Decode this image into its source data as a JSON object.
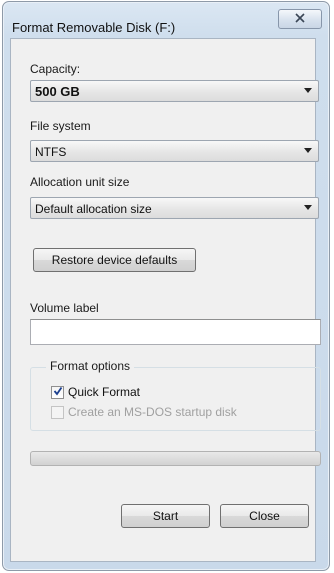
{
  "window": {
    "title": "Format Removable Disk (F:)"
  },
  "capacity": {
    "label": "Capacity:",
    "value": "500 GB"
  },
  "file_system": {
    "label": "File system",
    "value": "NTFS"
  },
  "allocation": {
    "label": "Allocation unit size",
    "value": "Default allocation size"
  },
  "restore_button": {
    "label": "Restore device defaults"
  },
  "volume_label": {
    "label": "Volume label",
    "value": ""
  },
  "format_options": {
    "title": "Format options",
    "quick_format": {
      "label": "Quick Format",
      "checked": true
    },
    "msdos_disk": {
      "label": "Create an MS-DOS startup disk",
      "checked": false,
      "enabled": false
    }
  },
  "progress": {
    "value": 0
  },
  "buttons": {
    "start": "Start",
    "close": "Close"
  },
  "icons": {
    "close": "close-icon",
    "dropdown": "chevron-down-icon",
    "check": "checkmark-icon"
  }
}
